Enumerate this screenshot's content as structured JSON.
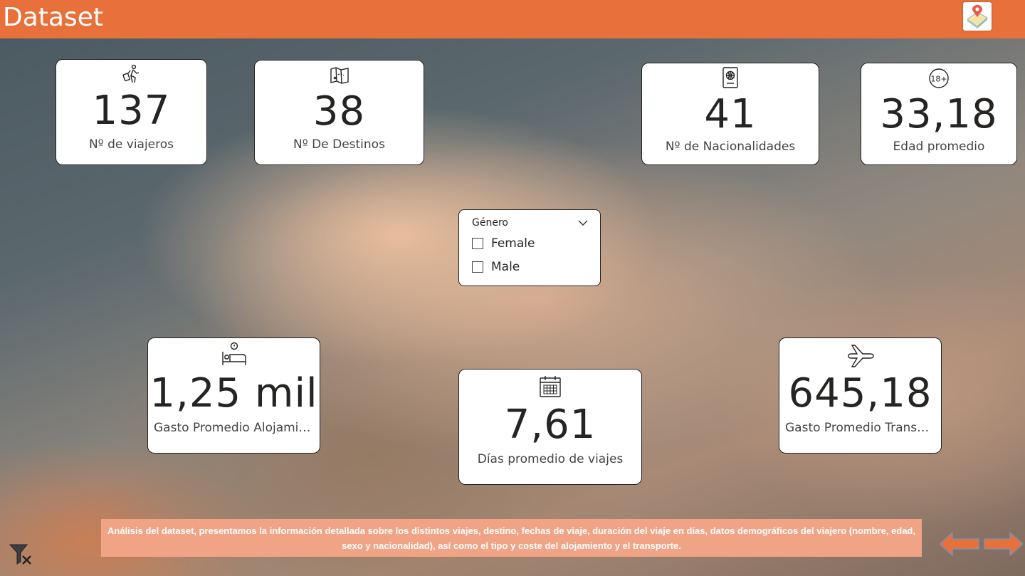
{
  "header": {
    "title": "Dataset",
    "background_color": "#e8703a",
    "logo_icon": "map-pin-icon"
  },
  "kpis": {
    "travelers": {
      "value": "137",
      "label": "Nº de viajeros",
      "icon": "traveler-luggage-icon"
    },
    "destinations": {
      "value": "38",
      "label": "Nº De Destinos",
      "icon": "folded-map-icon"
    },
    "nationalities": {
      "value": "41",
      "label": "Nº de Nacionalidades",
      "icon": "passport-icon"
    },
    "avg_age": {
      "value": "33,18",
      "label": "Edad promedio",
      "icon": "age-18-plus-icon"
    },
    "lodging_cost": {
      "value": "1,25 mil",
      "label": "Gasto Promedio Alojamie...",
      "icon": "bed-icon"
    },
    "avg_days": {
      "value": "7,61",
      "label": "Días promedio de viajes",
      "icon": "calendar-icon"
    },
    "transport_cost": {
      "value": "645,18",
      "label": "Gasto Promedio Transp...",
      "icon": "airplane-icon"
    }
  },
  "gender_slicer": {
    "title": "Género",
    "options": [
      {
        "label": "Female",
        "checked": false
      },
      {
        "label": "Male",
        "checked": false
      }
    ]
  },
  "footer": {
    "description": "Análisis del dataset, presentamos la información detallada sobre los distintos viajes, destino, fechas de viaje, duración del viaje en días, datos demográficos del viajero (nombre, edad, sexo y nacionalidad), así como el tipo y coste del alojamiento y el transporte.",
    "background_color": "#f0a385"
  },
  "navigation": {
    "back_icon": "arrow-left-icon",
    "next_icon": "arrow-right-icon",
    "clear_filters_icon": "clear-filter-icon",
    "arrow_color": "#e8703a"
  }
}
